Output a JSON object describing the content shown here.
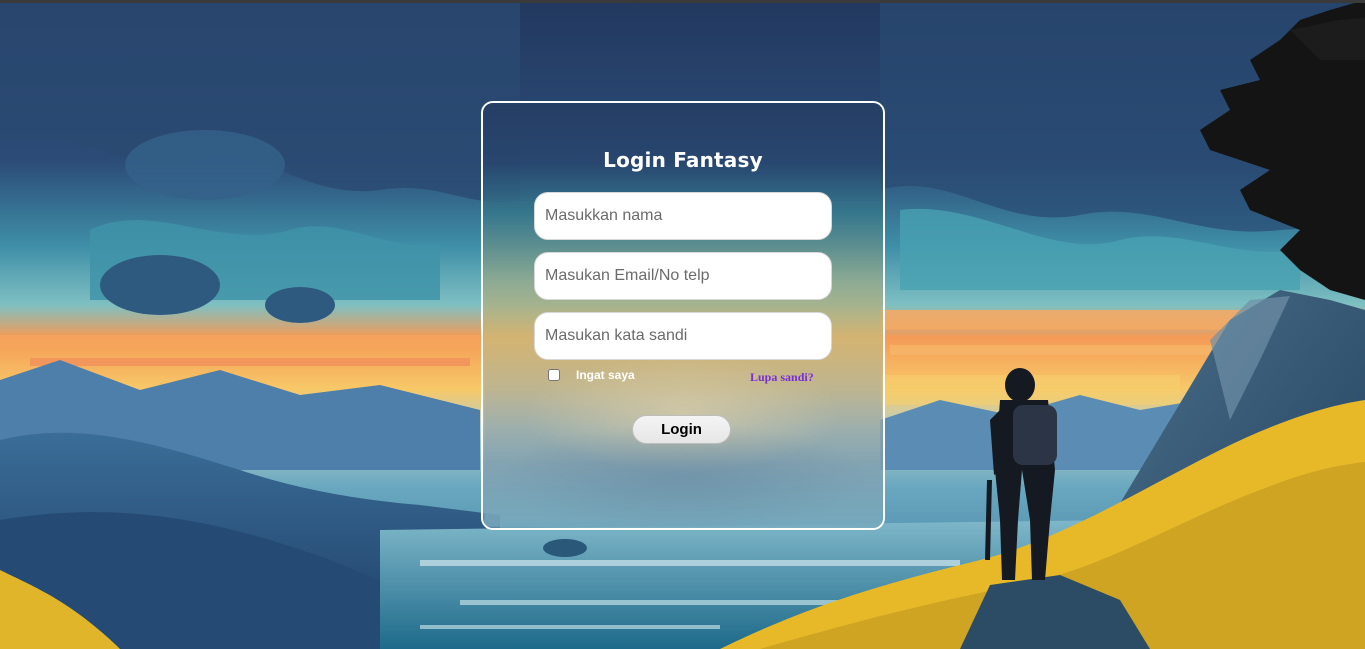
{
  "form": {
    "title": "Login Fantasy",
    "name_placeholder": "Masukkan nama",
    "email_placeholder": "Masukan Email/No telp",
    "password_placeholder": "Masukan kata sandi",
    "remember_label": "Ingat saya",
    "remember_checked": false,
    "forgot_link": "Lupa sandi?",
    "login_button": "Login"
  },
  "colors": {
    "card_border": "#ffffff",
    "title_text": "#ffffff",
    "forgot_link": "#7a2fd6",
    "button_bg": "#eeeeee"
  },
  "background": {
    "description_icon": "fantasy-landscape-hiker-illustration"
  }
}
